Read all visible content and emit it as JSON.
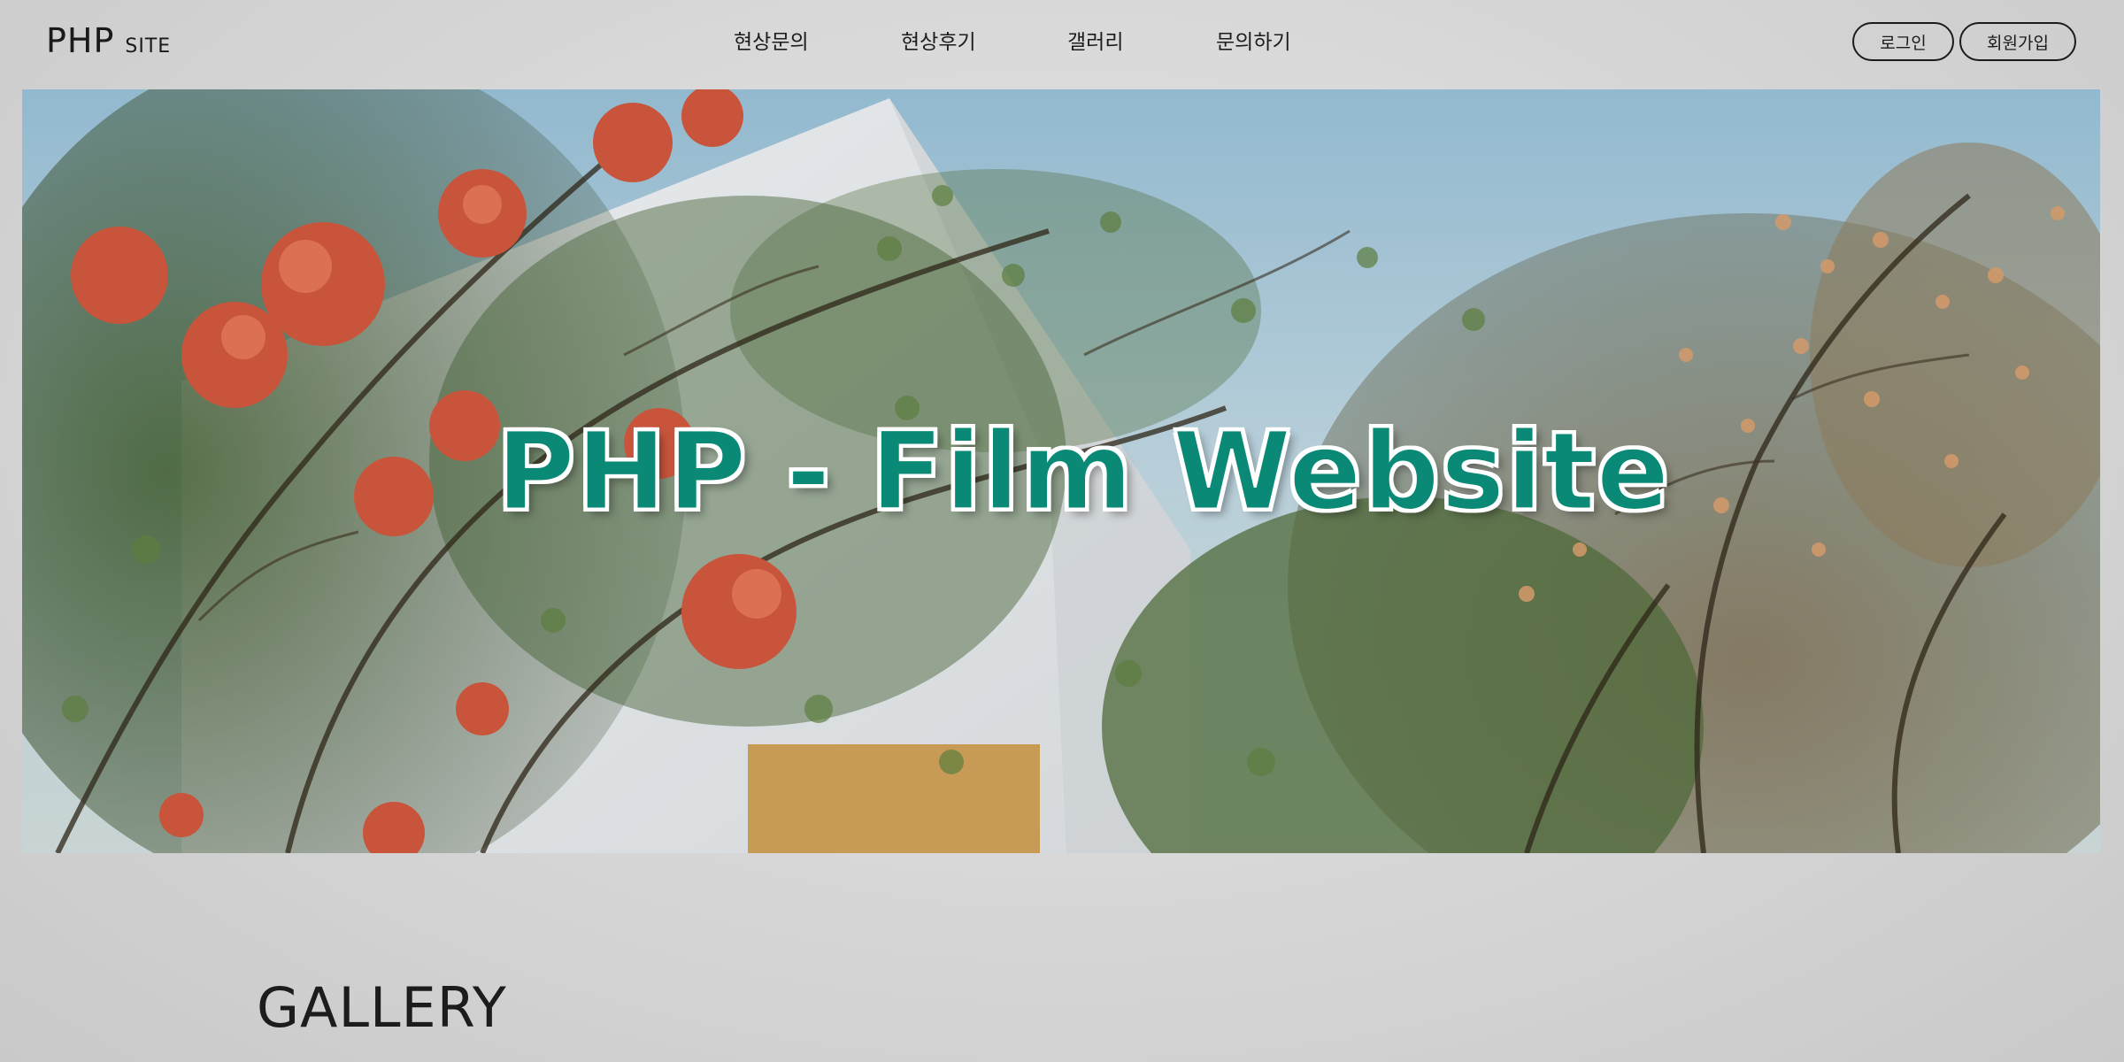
{
  "header": {
    "logo_main": "PHP",
    "logo_sub": "SITE",
    "nav": [
      "현상문의",
      "현상후기",
      "갤러리",
      "문의하기"
    ],
    "login_label": "로그인",
    "signup_label": "회원가입"
  },
  "hero": {
    "title": "PHP - Film Website",
    "title_color": "#0a8a76"
  },
  "gallery": {
    "heading": "GALLERY"
  }
}
